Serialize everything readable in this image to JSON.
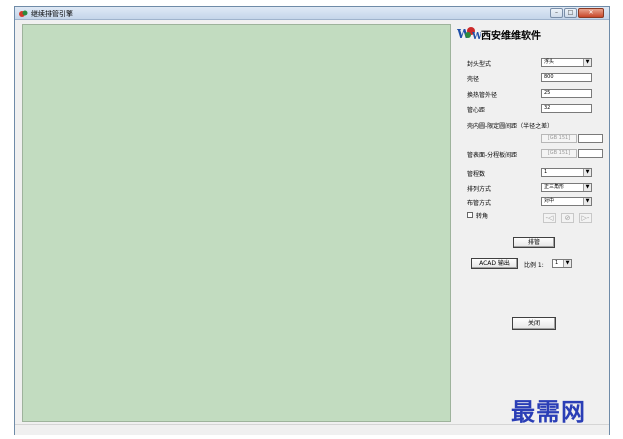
{
  "window": {
    "title": "继续排管引擎",
    "minimize_glyph": "–",
    "maximize_glyph": "□",
    "close_glyph": "✕"
  },
  "brand": {
    "text": "西安维维软件"
  },
  "form": {
    "head_type_label": "封头型式",
    "head_type_value": "浮头",
    "shell_dia_label": "壳径",
    "shell_dia_value": "800",
    "tube_od_label": "换热管外径",
    "tube_od_value": "25",
    "pitch_label": "管心距",
    "pitch_value": "32",
    "inner_circle_label": "壳内圆-限定圆间距（半径之差）",
    "gb_label": "[GB 151]",
    "tube_pass_gap_label": "管表面-分程板间距",
    "passes_label": "管程数",
    "passes_value": "1",
    "arrangement_label": "排列方式",
    "arrangement_value": "正三角形",
    "layout_label": "布管方式",
    "layout_value": "对中",
    "rotate_label": "转角",
    "rotate_icons": [
      "arrow-left-icon",
      "no-entry-icon",
      "arrow-right-icon"
    ],
    "rotate_glyphs": [
      "-◁",
      "⊘",
      "▷-"
    ]
  },
  "actions": {
    "layout_btn": "排管",
    "acad_btn": "ACAD 输出",
    "scale_label": "比例 1:",
    "scale_value": "1",
    "close_btn": "关闭"
  },
  "watermark": "最需网",
  "colors": {
    "canvas": "#c2dcc0",
    "watermark": "#2a3eb6"
  }
}
